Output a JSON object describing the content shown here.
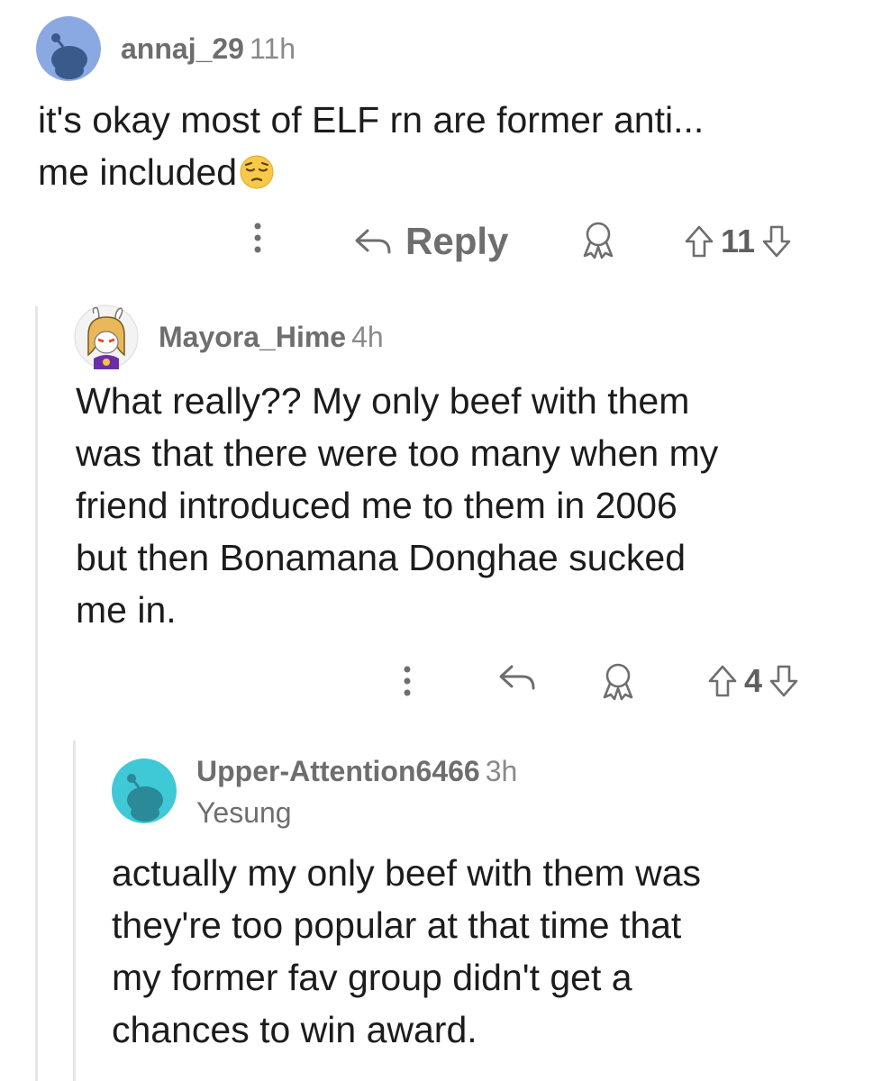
{
  "comments": [
    {
      "username": "annaj_29",
      "time": "11h",
      "text_lines": [
        "it's okay most of ELF rn are former anti...",
        "me included"
      ],
      "emoji": "pensive-face",
      "reply_label": "Reply",
      "score": "11"
    },
    {
      "username": "Mayora_Hime",
      "time": "4h",
      "text_lines": [
        "What really?? My only beef with them",
        "was that there were too many when my",
        "friend introduced me to them in 2006",
        "but then Bonamana Donghae sucked",
        "me in."
      ],
      "score": "4"
    },
    {
      "username": "Upper-Attention6466",
      "time": "3h",
      "flair": "Yesung",
      "text_lines": [
        "actually my only beef with them was",
        "they're too popular at that time that",
        "my former fav group didn't get a",
        "chances to win award."
      ]
    }
  ],
  "colors": {
    "avatar_blue": "#8aa9e3",
    "avatar_teal": "#3fc8d6",
    "snoo_dark": "#3a5a8c"
  }
}
